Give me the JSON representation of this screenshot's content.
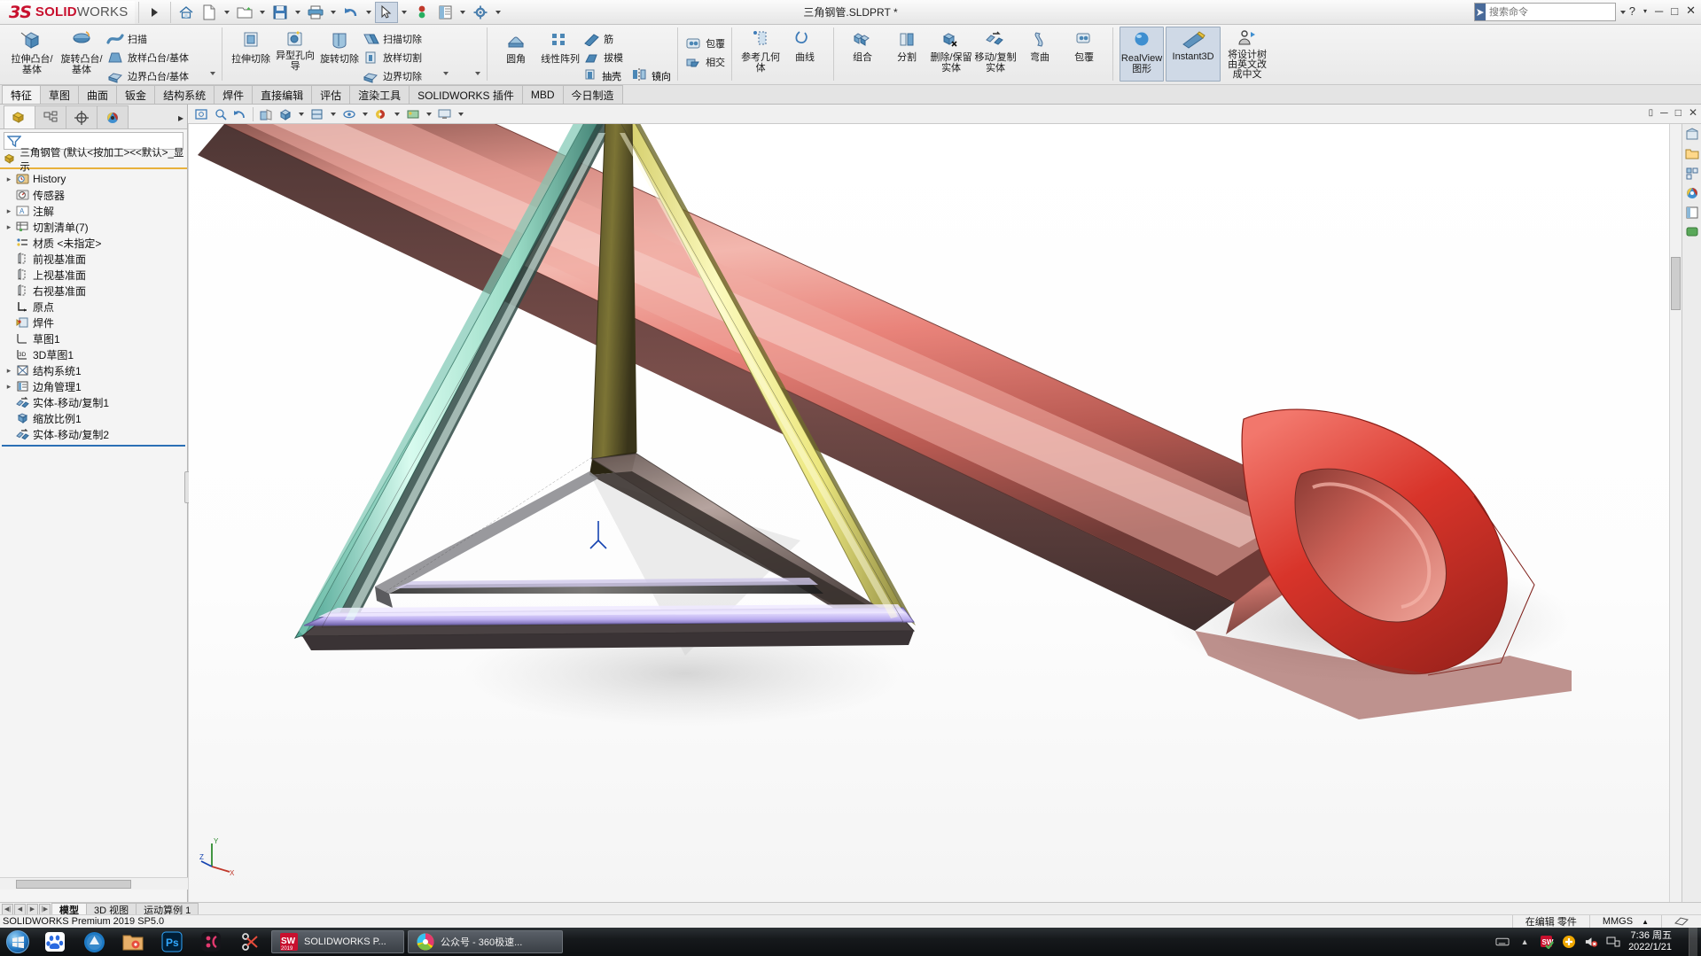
{
  "app": {
    "brand": "SOLIDWORKS",
    "brand_prefix": "SOLID",
    "brand_suffix": "WORKS",
    "document_title": "三角钢管.SLDPRT *",
    "version_status": "SOLIDWORKS Premium 2019 SP5.0"
  },
  "titlebar": {
    "icons": [
      {
        "name": "home-icon",
        "label": "主页"
      },
      {
        "name": "new-document-icon",
        "label": "新建"
      },
      {
        "name": "open-folder-icon",
        "label": "打开"
      },
      {
        "name": "save-icon",
        "label": "保存"
      },
      {
        "name": "print-icon",
        "label": "打印"
      },
      {
        "name": "undo-icon",
        "label": "撤销"
      },
      {
        "name": "select-cursor-icon",
        "label": "选择"
      },
      {
        "name": "rebuild-icon",
        "label": "重建模型"
      },
      {
        "name": "file-properties-icon",
        "label": "文件属性"
      },
      {
        "name": "options-gear-icon",
        "label": "选项"
      }
    ],
    "search": {
      "placeholder": "搜索命令",
      "value": "",
      "icon": "search-icon"
    },
    "help_label": "?",
    "window_buttons": [
      "minimize",
      "maximize",
      "close"
    ]
  },
  "ribbon": {
    "groups": [
      {
        "name": "features-create",
        "buttons": [
          {
            "label": "拉伸凸台/基体",
            "icon": "extrude-boss-icon",
            "type": "big"
          },
          {
            "label": "旋转凸台/基体",
            "icon": "revolve-boss-icon",
            "type": "big"
          }
        ],
        "rows": [
          {
            "label": "扫描",
            "icon": "sweep-icon"
          },
          {
            "label": "放样凸台/基体",
            "icon": "loft-icon"
          },
          {
            "label": "边界凸台/基体",
            "icon": "boundary-boss-icon"
          }
        ]
      },
      {
        "name": "features-cut",
        "buttons": [
          {
            "label": "拉伸切除",
            "icon": "extruded-cut-icon",
            "type": "big"
          },
          {
            "label": "异型孔向导",
            "icon": "hole-wizard-icon",
            "type": "big"
          },
          {
            "label": "旋转切除",
            "icon": "revolved-cut-icon",
            "type": "big"
          }
        ],
        "rows": [
          {
            "label": "扫描切除",
            "icon": "swept-cut-icon"
          },
          {
            "label": "放样切割",
            "icon": "lofted-cut-icon"
          },
          {
            "label": "边界切除",
            "icon": "boundary-cut-icon"
          }
        ]
      },
      {
        "name": "features-modify",
        "buttons": [
          {
            "label": "圆角",
            "icon": "fillet-icon",
            "type": "big"
          },
          {
            "label": "线性阵列",
            "icon": "linear-pattern-icon",
            "type": "big"
          }
        ],
        "rows": [
          {
            "label": "筋",
            "icon": "rib-icon"
          },
          {
            "label": "拔模",
            "icon": "draft-icon"
          },
          {
            "label": "抽壳",
            "icon": "shell-icon"
          },
          {
            "label": "镜向",
            "icon": "mirror-icon"
          }
        ]
      },
      {
        "name": "features-wrap",
        "rows": [
          {
            "label": "包覆",
            "icon": "wrap-icon"
          },
          {
            "label": "相交",
            "icon": "intersect-icon"
          }
        ]
      },
      {
        "name": "reference",
        "buttons": [
          {
            "label": "参考几何体",
            "icon": "reference-geometry-icon",
            "type": "big"
          },
          {
            "label": "曲线",
            "icon": "curves-icon",
            "type": "big"
          }
        ]
      },
      {
        "name": "bodies",
        "buttons": [
          {
            "label": "组合",
            "icon": "combine-icon",
            "type": "big"
          },
          {
            "label": "分割",
            "icon": "split-icon",
            "type": "big"
          },
          {
            "label": "删除/保留实体",
            "icon": "delete-keep-body-icon",
            "type": "big"
          },
          {
            "label": "移动/复制实体",
            "icon": "move-copy-body-icon",
            "type": "big"
          },
          {
            "label": "弯曲",
            "icon": "flex-icon",
            "type": "big"
          },
          {
            "label": "包覆",
            "icon": "wrap-body-icon",
            "type": "big"
          }
        ]
      },
      {
        "name": "display",
        "buttons": [
          {
            "label": "RealView 图形",
            "icon": "realview-sphere-icon",
            "type": "big",
            "toggled": true
          },
          {
            "label": "Instant3D",
            "icon": "instant3d-icon",
            "type": "big",
            "toggled": true
          },
          {
            "label": "将设计树由英文改成中文",
            "icon": "person-arrow-icon",
            "type": "big"
          }
        ]
      }
    ]
  },
  "command_tabs": {
    "items": [
      {
        "label": "特征",
        "active": true
      },
      {
        "label": "草图",
        "active": false
      },
      {
        "label": "曲面",
        "active": false
      },
      {
        "label": "钣金",
        "active": false
      },
      {
        "label": "结构系统",
        "active": false
      },
      {
        "label": "焊件",
        "active": false
      },
      {
        "label": "直接编辑",
        "active": false
      },
      {
        "label": "评估",
        "active": false
      },
      {
        "label": "渲染工具",
        "active": false
      },
      {
        "label": "SOLIDWORKS 插件",
        "active": false
      },
      {
        "label": "MBD",
        "active": false
      },
      {
        "label": "今日制造",
        "active": false
      }
    ]
  },
  "view_toolbar": {
    "buttons": [
      {
        "name": "zoom-to-fit-icon",
        "label": "整屏显示全图"
      },
      {
        "name": "zoom-to-area-icon",
        "label": "局部放大"
      },
      {
        "name": "previous-view-icon",
        "label": "上一视图"
      },
      {
        "name": "section-view-icon",
        "label": "剖面视图"
      },
      {
        "name": "view-orientation-icon",
        "label": "视图定向"
      },
      {
        "name": "display-style-icon",
        "label": "显示样式"
      },
      {
        "name": "hide-show-items-icon",
        "label": "隐藏/显示项目"
      },
      {
        "name": "edit-appearance-icon",
        "label": "编辑外观"
      },
      {
        "name": "apply-scene-icon",
        "label": "应用布景"
      },
      {
        "name": "view-settings-icon",
        "label": "视图设定"
      }
    ]
  },
  "feature_manager": {
    "tabs": [
      {
        "name": "feature-manager-tab",
        "icon": "feature-tree-icon",
        "active": true
      },
      {
        "name": "property-manager-tab",
        "icon": "property-manager-icon",
        "active": false
      },
      {
        "name": "configuration-manager-tab",
        "icon": "configuration-icon",
        "active": false
      },
      {
        "name": "display-manager-tab",
        "icon": "display-manager-icon",
        "active": false
      }
    ],
    "filter": {
      "placeholder": "",
      "value": "",
      "icon": "filter-icon"
    },
    "root": {
      "label": "三角钢管  (默认<按加工><<默认>_显示",
      "icon": "part-icon"
    },
    "nodes": [
      {
        "label": "History",
        "icon": "history-icon",
        "expandable": true,
        "indent": 0
      },
      {
        "label": "传感器",
        "icon": "sensor-icon",
        "expandable": false,
        "indent": 0
      },
      {
        "label": "注解",
        "icon": "annotations-icon",
        "expandable": true,
        "indent": 0
      },
      {
        "label": "切割清单(7)",
        "icon": "cut-list-icon",
        "expandable": true,
        "indent": 0
      },
      {
        "label": "材质 <未指定>",
        "icon": "material-icon",
        "expandable": false,
        "indent": 0
      },
      {
        "label": "前视基准面",
        "icon": "plane-icon",
        "expandable": false,
        "indent": 0
      },
      {
        "label": "上视基准面",
        "icon": "plane-icon",
        "expandable": false,
        "indent": 0
      },
      {
        "label": "右视基准面",
        "icon": "plane-icon",
        "expandable": false,
        "indent": 0
      },
      {
        "label": "原点",
        "icon": "origin-icon",
        "expandable": false,
        "indent": 0
      },
      {
        "label": "焊件",
        "icon": "weldment-icon",
        "expandable": false,
        "indent": 0
      },
      {
        "label": "草图1",
        "icon": "sketch-icon",
        "expandable": false,
        "indent": 0
      },
      {
        "label": "3D草图1",
        "icon": "sketch3d-icon",
        "expandable": false,
        "indent": 0
      },
      {
        "label": "结构系统1",
        "icon": "structure-system-icon",
        "expandable": true,
        "indent": 0
      },
      {
        "label": "边角管理1",
        "icon": "corner-management-icon",
        "expandable": true,
        "indent": 0
      },
      {
        "label": "实体-移动/复制1",
        "icon": "move-copy-body-icon",
        "expandable": false,
        "indent": 0
      },
      {
        "label": "缩放比例1",
        "icon": "scale-icon",
        "expandable": false,
        "indent": 0
      },
      {
        "label": "实体-移动/复制2",
        "icon": "move-copy-body-icon",
        "expandable": false,
        "indent": 0
      }
    ]
  },
  "bottom_tabs": {
    "nav": [
      "first",
      "prev",
      "next",
      "last"
    ],
    "items": [
      {
        "label": "模型",
        "active": true
      },
      {
        "label": "3D 视图",
        "active": false
      },
      {
        "label": "运动算例 1",
        "active": false
      }
    ]
  },
  "status_bar": {
    "left": "SOLIDWORKS Premium 2019 SP5.0",
    "editing": "在编辑 零件",
    "units": "MMGS",
    "units_caret": "▲"
  },
  "taskbar": {
    "start": "start-orb-icon",
    "apps": [
      {
        "name": "taskbar-app-baidu",
        "icon": "baidu-icon"
      },
      {
        "name": "taskbar-app-360browser",
        "icon": "browser-icon"
      },
      {
        "name": "taskbar-app-folder",
        "icon": "folder-icon"
      },
      {
        "name": "taskbar-app-photoshop",
        "icon": "ps-icon",
        "label": "Ps"
      },
      {
        "name": "taskbar-app-obs",
        "icon": "obs-icon"
      },
      {
        "name": "taskbar-app-snip",
        "icon": "scissors-icon"
      }
    ],
    "windows": [
      {
        "name": "taskbar-window-solidworks",
        "label": "SOLIDWORKS P...",
        "icon": "sw-2019-icon",
        "badge": "2019",
        "active": true
      },
      {
        "name": "taskbar-window-browser",
        "label": "公众号 - 360极速...",
        "icon": "360-speed-icon",
        "active": false
      }
    ],
    "tray": [
      {
        "name": "keyboard-icon"
      },
      {
        "name": "tray-expand-icon"
      },
      {
        "name": "solidworks-tray-icon"
      },
      {
        "name": "update-icon"
      },
      {
        "name": "volume-muted-icon"
      },
      {
        "name": "network-icon"
      }
    ],
    "clock": {
      "time": "7:36 周五",
      "date": "2022/1/21"
    }
  },
  "model": {
    "name": "三角钢管",
    "colors": {
      "tube_red": "#e8685f",
      "tube_red_dark": "#c2362e",
      "edge_teal": "#a8e8d4",
      "edge_yellow": "#f5ef9a",
      "edge_purple": "#c9bdf0",
      "edge_olive": "#7a7331",
      "accent_blue": "#2b6fb5",
      "highlight_orange": "#e8b13c"
    }
  }
}
